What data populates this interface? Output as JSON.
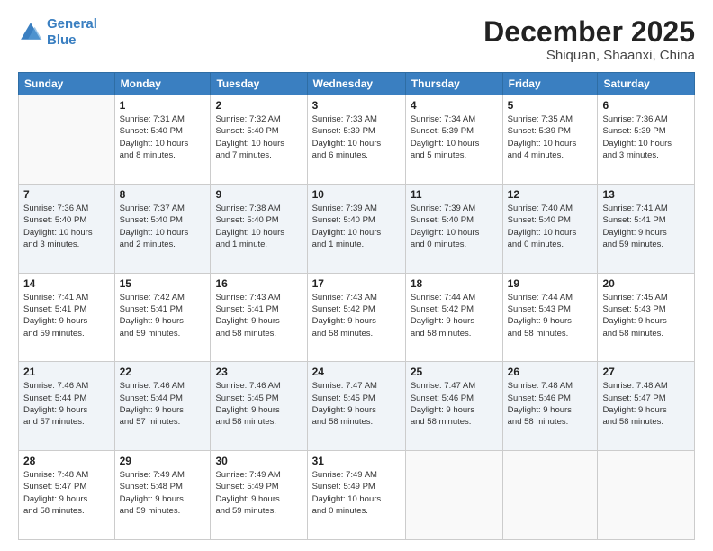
{
  "header": {
    "logo_line1": "General",
    "logo_line2": "Blue",
    "month": "December 2025",
    "location": "Shiquan, Shaanxi, China"
  },
  "days_of_week": [
    "Sunday",
    "Monday",
    "Tuesday",
    "Wednesday",
    "Thursday",
    "Friday",
    "Saturday"
  ],
  "weeks": [
    [
      {
        "day": "",
        "info": ""
      },
      {
        "day": "1",
        "info": "Sunrise: 7:31 AM\nSunset: 5:40 PM\nDaylight: 10 hours\nand 8 minutes."
      },
      {
        "day": "2",
        "info": "Sunrise: 7:32 AM\nSunset: 5:40 PM\nDaylight: 10 hours\nand 7 minutes."
      },
      {
        "day": "3",
        "info": "Sunrise: 7:33 AM\nSunset: 5:39 PM\nDaylight: 10 hours\nand 6 minutes."
      },
      {
        "day": "4",
        "info": "Sunrise: 7:34 AM\nSunset: 5:39 PM\nDaylight: 10 hours\nand 5 minutes."
      },
      {
        "day": "5",
        "info": "Sunrise: 7:35 AM\nSunset: 5:39 PM\nDaylight: 10 hours\nand 4 minutes."
      },
      {
        "day": "6",
        "info": "Sunrise: 7:36 AM\nSunset: 5:39 PM\nDaylight: 10 hours\nand 3 minutes."
      }
    ],
    [
      {
        "day": "7",
        "info": "Sunrise: 7:36 AM\nSunset: 5:40 PM\nDaylight: 10 hours\nand 3 minutes."
      },
      {
        "day": "8",
        "info": "Sunrise: 7:37 AM\nSunset: 5:40 PM\nDaylight: 10 hours\nand 2 minutes."
      },
      {
        "day": "9",
        "info": "Sunrise: 7:38 AM\nSunset: 5:40 PM\nDaylight: 10 hours\nand 1 minute."
      },
      {
        "day": "10",
        "info": "Sunrise: 7:39 AM\nSunset: 5:40 PM\nDaylight: 10 hours\nand 1 minute."
      },
      {
        "day": "11",
        "info": "Sunrise: 7:39 AM\nSunset: 5:40 PM\nDaylight: 10 hours\nand 0 minutes."
      },
      {
        "day": "12",
        "info": "Sunrise: 7:40 AM\nSunset: 5:40 PM\nDaylight: 10 hours\nand 0 minutes."
      },
      {
        "day": "13",
        "info": "Sunrise: 7:41 AM\nSunset: 5:41 PM\nDaylight: 9 hours\nand 59 minutes."
      }
    ],
    [
      {
        "day": "14",
        "info": "Sunrise: 7:41 AM\nSunset: 5:41 PM\nDaylight: 9 hours\nand 59 minutes."
      },
      {
        "day": "15",
        "info": "Sunrise: 7:42 AM\nSunset: 5:41 PM\nDaylight: 9 hours\nand 59 minutes."
      },
      {
        "day": "16",
        "info": "Sunrise: 7:43 AM\nSunset: 5:41 PM\nDaylight: 9 hours\nand 58 minutes."
      },
      {
        "day": "17",
        "info": "Sunrise: 7:43 AM\nSunset: 5:42 PM\nDaylight: 9 hours\nand 58 minutes."
      },
      {
        "day": "18",
        "info": "Sunrise: 7:44 AM\nSunset: 5:42 PM\nDaylight: 9 hours\nand 58 minutes."
      },
      {
        "day": "19",
        "info": "Sunrise: 7:44 AM\nSunset: 5:43 PM\nDaylight: 9 hours\nand 58 minutes."
      },
      {
        "day": "20",
        "info": "Sunrise: 7:45 AM\nSunset: 5:43 PM\nDaylight: 9 hours\nand 58 minutes."
      }
    ],
    [
      {
        "day": "21",
        "info": "Sunrise: 7:46 AM\nSunset: 5:44 PM\nDaylight: 9 hours\nand 57 minutes."
      },
      {
        "day": "22",
        "info": "Sunrise: 7:46 AM\nSunset: 5:44 PM\nDaylight: 9 hours\nand 57 minutes."
      },
      {
        "day": "23",
        "info": "Sunrise: 7:46 AM\nSunset: 5:45 PM\nDaylight: 9 hours\nand 58 minutes."
      },
      {
        "day": "24",
        "info": "Sunrise: 7:47 AM\nSunset: 5:45 PM\nDaylight: 9 hours\nand 58 minutes."
      },
      {
        "day": "25",
        "info": "Sunrise: 7:47 AM\nSunset: 5:46 PM\nDaylight: 9 hours\nand 58 minutes."
      },
      {
        "day": "26",
        "info": "Sunrise: 7:48 AM\nSunset: 5:46 PM\nDaylight: 9 hours\nand 58 minutes."
      },
      {
        "day": "27",
        "info": "Sunrise: 7:48 AM\nSunset: 5:47 PM\nDaylight: 9 hours\nand 58 minutes."
      }
    ],
    [
      {
        "day": "28",
        "info": "Sunrise: 7:48 AM\nSunset: 5:47 PM\nDaylight: 9 hours\nand 58 minutes."
      },
      {
        "day": "29",
        "info": "Sunrise: 7:49 AM\nSunset: 5:48 PM\nDaylight: 9 hours\nand 59 minutes."
      },
      {
        "day": "30",
        "info": "Sunrise: 7:49 AM\nSunset: 5:49 PM\nDaylight: 9 hours\nand 59 minutes."
      },
      {
        "day": "31",
        "info": "Sunrise: 7:49 AM\nSunset: 5:49 PM\nDaylight: 10 hours\nand 0 minutes."
      },
      {
        "day": "",
        "info": ""
      },
      {
        "day": "",
        "info": ""
      },
      {
        "day": "",
        "info": ""
      }
    ]
  ]
}
